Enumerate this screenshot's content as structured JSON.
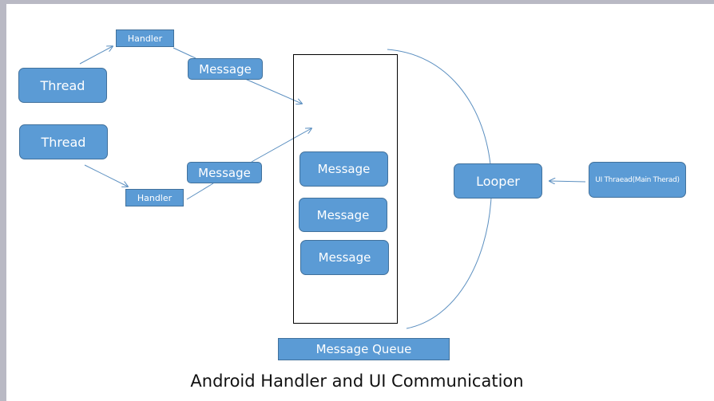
{
  "diagram": {
    "title": "Android Handler and UI Communication",
    "colors": {
      "node_fill": "#5b9bd5",
      "node_border": "#41719c",
      "node_text": "#ffffff",
      "connector": "#5b8fc0",
      "queue_border": "#000000",
      "caption_text": "#111111"
    },
    "threads": [
      {
        "label": "Thread"
      },
      {
        "label": "Thread"
      }
    ],
    "handlers": [
      {
        "label": "Handler"
      },
      {
        "label": "Handler"
      }
    ],
    "incoming_messages": [
      {
        "label": "Message"
      },
      {
        "label": "Message"
      }
    ],
    "queue": {
      "label": "Message Queue",
      "messages": [
        {
          "label": "Message"
        },
        {
          "label": "Message"
        },
        {
          "label": "Message"
        }
      ]
    },
    "looper": {
      "label": "Looper"
    },
    "ui_thread": {
      "label": "UI Thraead(Main Therad)"
    }
  }
}
